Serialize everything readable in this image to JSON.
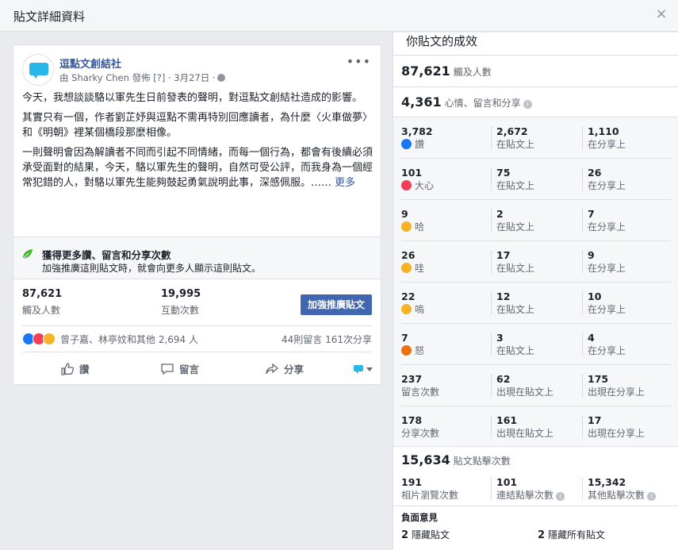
{
  "dialog": {
    "title": "貼文詳細資料",
    "close_glyph": "×"
  },
  "post": {
    "page_name": "逗點文創結社",
    "meta": "由 Sharky Chen 發佈 [?] · 3月27日 ·",
    "paragraphs": [
      "今天，我想談談駱以軍先生日前發表的聲明，對逗點文創結社造成的影響。",
      "其實只有一個，作者劉芷妤與逗點不需再特別回應讀者，為什麼〈火車做夢〉和《明朝》裡某個橋段那麼相像。",
      "一則聲明會因為解讀者不同而引起不同情緒，而每一個行為，都會有後續必須承受面對的結果，今天，駱以軍先生的聲明，自然可受公評，而我身為一個經常犯錯的人，對駱以軍先生能夠鼓起勇氣說明此事，深感佩服。……"
    ],
    "see_more": "更多",
    "boost_title": "獲得更多讚、留言和分享次數",
    "boost_desc": "加強推廣這則貼文時，就會向更多人顯示這則貼文。",
    "reach_value": "87,621",
    "reach_label": "觸及人數",
    "engage_value": "19,995",
    "engage_label": "互動次數",
    "boost_button": "加強推廣貼文",
    "reaction_names": "曾子嘉、林亭妏和其他 2,694 人",
    "reaction_counts": "44則留言  161次分享",
    "actions": {
      "like": "讚",
      "comment": "留言",
      "share": "分享"
    }
  },
  "performance": {
    "title": "你貼文的成效",
    "reach": {
      "value": "87,621",
      "label": "觸及人數"
    },
    "engagement": {
      "value": "4,361",
      "label": "心情、留言和分享"
    },
    "rows": [
      {
        "icon": "like-emoji-icon",
        "c1": [
          "3,782",
          "讚"
        ],
        "c2": [
          "2,672",
          "在貼文上"
        ],
        "c3": [
          "1,110",
          "在分享上"
        ]
      },
      {
        "icon": "love-emoji-icon",
        "c1": [
          "101",
          "大心"
        ],
        "c2": [
          "75",
          "在貼文上"
        ],
        "c3": [
          "26",
          "在分享上"
        ]
      },
      {
        "icon": "haha-emoji-icon",
        "c1": [
          "9",
          "哈"
        ],
        "c2": [
          "2",
          "在貼文上"
        ],
        "c3": [
          "7",
          "在分享上"
        ]
      },
      {
        "icon": "wow-emoji-icon",
        "c1": [
          "26",
          "哇"
        ],
        "c2": [
          "17",
          "在貼文上"
        ],
        "c3": [
          "9",
          "在分享上"
        ]
      },
      {
        "icon": "sad-emoji-icon",
        "c1": [
          "22",
          "嗚"
        ],
        "c2": [
          "12",
          "在貼文上"
        ],
        "c3": [
          "10",
          "在分享上"
        ]
      },
      {
        "icon": "angry-emoji-icon",
        "c1": [
          "7",
          "怒"
        ],
        "c2": [
          "3",
          "在貼文上"
        ],
        "c3": [
          "4",
          "在分享上"
        ]
      },
      {
        "icon": "",
        "c1": [
          "237",
          "留言次數"
        ],
        "c2": [
          "62",
          "出現在貼文上"
        ],
        "c3": [
          "175",
          "出現在分享上"
        ]
      },
      {
        "icon": "",
        "c1": [
          "178",
          "分享次數"
        ],
        "c2": [
          "161",
          "出現在貼文上"
        ],
        "c3": [
          "17",
          "出現在分享上"
        ]
      }
    ],
    "clicks": {
      "value": "15,634",
      "label": "貼文點擊次數"
    },
    "click_breakdown": [
      [
        "191",
        "相片瀏覽次數"
      ],
      [
        "101",
        "連結點擊次數"
      ],
      [
        "15,342",
        "其他點擊次數"
      ]
    ],
    "negative": {
      "title": "負面意見",
      "items": [
        [
          "2",
          "隱藏貼文"
        ],
        [
          "2",
          "隱藏所有貼文"
        ]
      ]
    },
    "colors": {
      "link": "#385898",
      "button": "#4267b2",
      "like": "#1877f2",
      "love": "#f33e58",
      "haha": "#f7b125",
      "angry": "#e9710f"
    }
  }
}
